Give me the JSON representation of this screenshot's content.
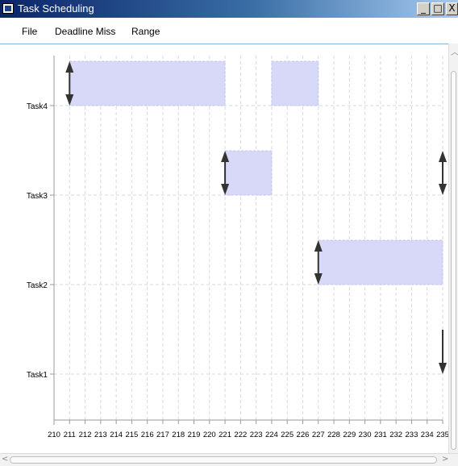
{
  "window": {
    "title": "Task Scheduling",
    "minimize_label": "_",
    "maximize_label": "□",
    "close_label": "X"
  },
  "menu": {
    "items": [
      "File",
      "Deadline Miss",
      "Range"
    ]
  },
  "colors": {
    "bar_fill": "#d8d8f8",
    "bar_stroke": "#c4c4e8",
    "grid": "#dadada",
    "arrow": "#333333",
    "titlebar_start": "#0a246a"
  },
  "chart_data": {
    "type": "gantt",
    "x_ticks": [
      210,
      211,
      212,
      213,
      214,
      215,
      216,
      217,
      218,
      219,
      220,
      221,
      222,
      223,
      224,
      225,
      226,
      227,
      228,
      229,
      230,
      231,
      232,
      233,
      234,
      235
    ],
    "categories": [
      "Task4",
      "Task3",
      "Task2",
      "Task1"
    ],
    "xlim": [
      210,
      235
    ],
    "grid": true,
    "bars": [
      {
        "task": "Task4",
        "start": 211,
        "end": 221
      },
      {
        "task": "Task4",
        "start": 224,
        "end": 227
      },
      {
        "task": "Task3",
        "start": 221,
        "end": 224
      },
      {
        "task": "Task2",
        "start": 227,
        "end": 235
      }
    ],
    "arrows": [
      {
        "task": "Task4",
        "x": 211,
        "kind": "double"
      },
      {
        "task": "Task3",
        "x": 221,
        "kind": "double"
      },
      {
        "task": "Task3",
        "x": 235,
        "kind": "double"
      },
      {
        "task": "Task2",
        "x": 227,
        "kind": "double"
      },
      {
        "task": "Task1",
        "x": 235,
        "kind": "down"
      }
    ]
  }
}
